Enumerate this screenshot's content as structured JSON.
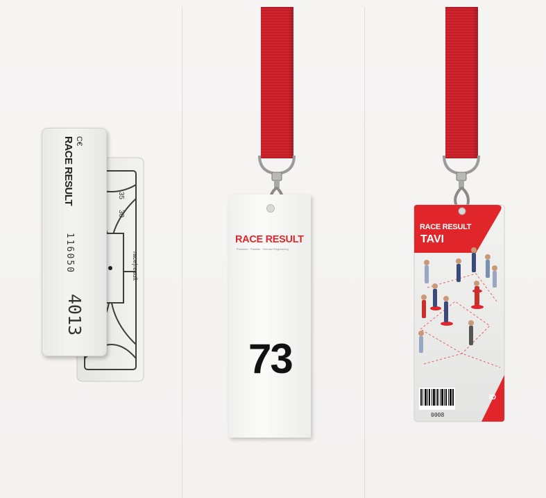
{
  "panel1": {
    "tag": {
      "ce_mark": "C€",
      "brand": "RACE RESULT",
      "serial": "116050",
      "number": "4013"
    },
    "chip": {
      "mark_35": "35",
      "mark_30": "30",
      "imprint": "race|result"
    }
  },
  "panel2": {
    "card": {
      "brand": "RACE RESULT",
      "tagline": "Precision · Passion · German Engineering",
      "number": "73"
    }
  },
  "panel3": {
    "card": {
      "brand": "RACE RESULT",
      "product": "TAVI",
      "badge": "ID",
      "barcode_number": "0008"
    }
  },
  "colors": {
    "lanyard": "#c8202a",
    "brand_red": "#e1262b",
    "background": "#f5f4f3"
  }
}
